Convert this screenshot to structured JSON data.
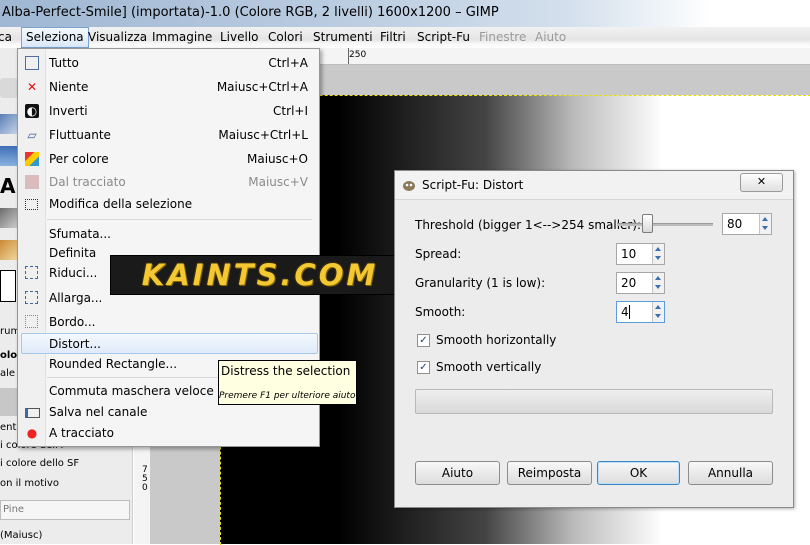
{
  "window": {
    "title": "Alba-Perfect-Smile] (importata)-1.0 (Colore RGB, 2 livelli) 1600x1200 – GIMP"
  },
  "menubar": {
    "items": [
      {
        "label": "ca",
        "state": "normal"
      },
      {
        "label": "Seleziona",
        "state": "active"
      },
      {
        "label": "Visualizza",
        "state": "normal"
      },
      {
        "label": "Immagine",
        "state": "normal"
      },
      {
        "label": "Livello",
        "state": "normal"
      },
      {
        "label": "Colori",
        "state": "normal"
      },
      {
        "label": "Strumenti",
        "state": "normal"
      },
      {
        "label": "Filtri",
        "state": "normal"
      },
      {
        "label": "Script-Fu",
        "state": "normal"
      },
      {
        "label": "Finestre",
        "state": "disabled"
      },
      {
        "label": "Aiuto",
        "state": "disabled"
      }
    ]
  },
  "ruler": {
    "h_tick": "250",
    "v_tick": "750"
  },
  "toolbox": {
    "fragments": [
      "rum",
      "olo",
      "ale",
      "ento",
      "i colore dell'F",
      "i colore dello SF",
      "on il motivo",
      "Pine",
      "(Maiusc)"
    ]
  },
  "select_menu": {
    "items": [
      {
        "label": "Tutto",
        "shortcut": "Ctrl+A",
        "icon": "select-all-icon",
        "glyph": "□",
        "enabled": true
      },
      {
        "label": "Niente",
        "shortcut": "Maiusc+Ctrl+A",
        "icon": "select-none-icon",
        "glyph": "✕",
        "enabled": true
      },
      {
        "label": "Inverti",
        "shortcut": "Ctrl+I",
        "icon": "invert-selection-icon",
        "glyph": "◐",
        "enabled": true
      },
      {
        "label": "Fluttuante",
        "shortcut": "Maiusc+Ctrl+L",
        "icon": "float-selection-icon",
        "glyph": "▱",
        "enabled": true
      },
      {
        "label": "Per colore",
        "shortcut": "Maiusc+O",
        "icon": "select-by-color-icon",
        "glyph": "▦",
        "enabled": true
      },
      {
        "label": "Dal tracciato",
        "shortcut": "Maiusc+V",
        "icon": "selection-from-path-icon",
        "glyph": "▩",
        "enabled": false
      },
      {
        "label": "Modifica della selezione",
        "shortcut": "",
        "icon": "selection-editor-icon",
        "glyph": "⬚",
        "enabled": true
      },
      {
        "label": "Sfumata...",
        "shortcut": "",
        "icon": "",
        "glyph": "",
        "enabled": true
      },
      {
        "label": "Definita",
        "shortcut": "",
        "icon": "",
        "glyph": "",
        "enabled": true
      },
      {
        "label": "Riduci...",
        "shortcut": "",
        "icon": "shrink-selection-icon",
        "glyph": "⬚",
        "enabled": true
      },
      {
        "label": "Allarga...",
        "shortcut": "",
        "icon": "grow-selection-icon",
        "glyph": "⬚",
        "enabled": true
      },
      {
        "label": "Bordo...",
        "shortcut": "",
        "icon": "border-selection-icon",
        "glyph": "⬚",
        "enabled": true
      },
      {
        "label": "Distort...",
        "shortcut": "",
        "icon": "",
        "glyph": "",
        "enabled": true
      },
      {
        "label": "Rounded Rectangle...",
        "shortcut": "",
        "icon": "",
        "glyph": "",
        "enabled": true
      },
      {
        "label": "Commuta maschera veloce",
        "shortcut": "",
        "icon": "",
        "glyph": "",
        "enabled": true
      },
      {
        "label": "Salva nel canale",
        "shortcut": "",
        "icon": "save-to-channel-icon",
        "glyph": "▭",
        "enabled": true
      },
      {
        "label": "A tracciato",
        "shortcut": "",
        "icon": "to-path-icon",
        "glyph": "●",
        "enabled": true
      }
    ],
    "highlighted": "Distort..."
  },
  "tooltip": {
    "text": "Distress the selection",
    "hint": "Premere F1 per ulteriore aiuto"
  },
  "logo": {
    "text": "KAINTS.COM"
  },
  "dialog": {
    "title": "Script-Fu: Distort",
    "close_label": "✕",
    "threshold": {
      "label": "Threshold (bigger 1<-->254 smaller):",
      "value": "80",
      "level": 80,
      "min": 1,
      "max": 254
    },
    "spread": {
      "label": "Spread:",
      "value": "10"
    },
    "granularity": {
      "label": "Granularity (1 is low):",
      "value": "20"
    },
    "smooth": {
      "label": "Smooth:",
      "value": "4"
    },
    "smooth_h": {
      "label": "Smooth horizontally",
      "checked": true
    },
    "smooth_v": {
      "label": "Smooth vertically",
      "checked": true
    },
    "buttons": {
      "help": "Aiuto",
      "reset": "Reimposta",
      "ok": "OK",
      "cancel": "Annulla"
    }
  },
  "colors": {
    "accent": "#3b83c7",
    "menu_highlight": "#dfeafa",
    "tooltip_bg": "#ffffe1",
    "logo_gold": "#f3c832",
    "selection_marquee": "#e8e000"
  }
}
